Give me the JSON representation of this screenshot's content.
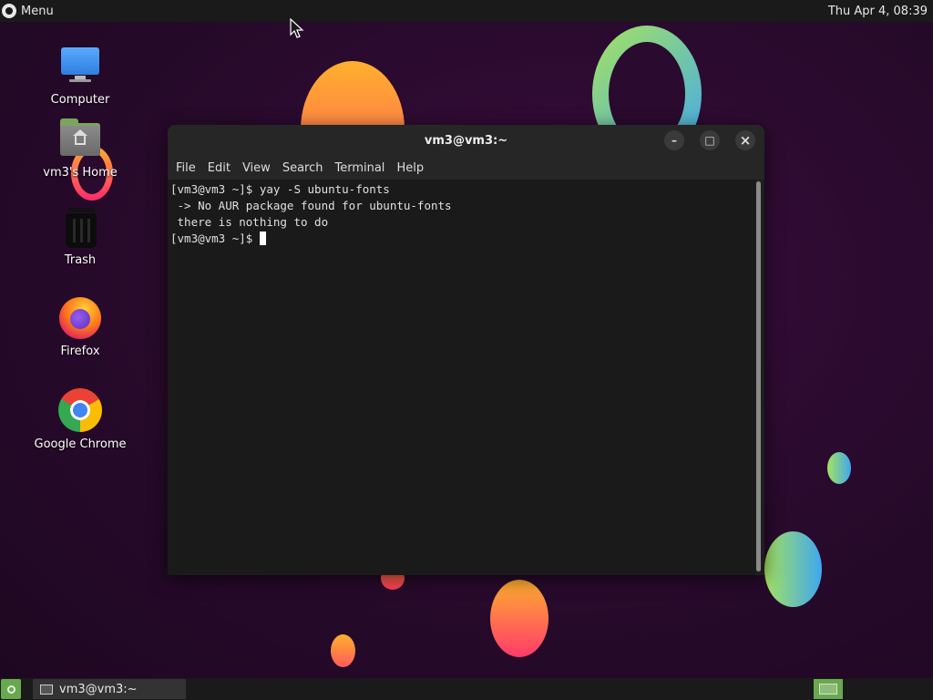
{
  "top_panel": {
    "menu_label": "Menu",
    "clock": "Thu Apr  4, 08:39"
  },
  "desktop": {
    "icons": [
      {
        "label": "Computer",
        "icon": "computer-icon"
      },
      {
        "label": "vm3's Home",
        "icon": "home-folder-icon"
      },
      {
        "label": "Trash",
        "icon": "trash-icon"
      },
      {
        "label": "Firefox",
        "icon": "firefox-icon"
      },
      {
        "label": "Google Chrome",
        "icon": "chrome-icon"
      }
    ]
  },
  "terminal": {
    "title": "vm3@vm3:~",
    "menu": [
      "File",
      "Edit",
      "View",
      "Search",
      "Terminal",
      "Help"
    ],
    "lines": [
      "[vm3@vm3 ~]$ yay -S ubuntu-fonts",
      " -> No AUR package found for ubuntu-fonts",
      " there is nothing to do",
      "[vm3@vm3 ~]$ "
    ],
    "controls": {
      "minimize": "–",
      "maximize": "□",
      "close": "×"
    }
  },
  "taskbar": {
    "items": [
      {
        "label": "vm3@vm3:~"
      }
    ]
  },
  "colors": {
    "panel": "#1a1a1a",
    "accent_green": "#6aa84f",
    "terminal_bg": "#1a1a1a"
  }
}
